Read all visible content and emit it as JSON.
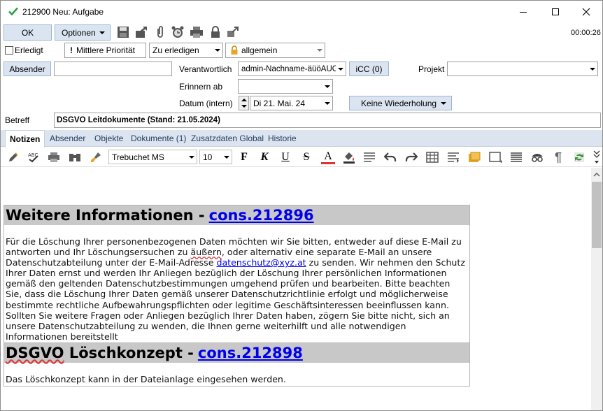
{
  "window": {
    "title": "212900 Neu: Aufgabe",
    "timer": "00:00:26"
  },
  "toolbar": {
    "ok_label": "OK",
    "options_label": "Optionen"
  },
  "row1": {
    "done_label": "Erledigt",
    "priority": "Mittlere Priorität",
    "status": "Zu erledigen",
    "category": "allgemein"
  },
  "row2": {
    "sender_button": "Absender",
    "sender_value": "",
    "responsible_label": "Verantwortlich",
    "responsible_value": "admin-Nachname-äüöÄÜÖß",
    "icc_button": "iCC (0)",
    "project_label": "Projekt",
    "project_value": ""
  },
  "row3": {
    "remind_label": "Erinnern ab",
    "remind_value": ""
  },
  "row4": {
    "date_label": "Datum (intern)",
    "date_value": "Di 21. Mai. 24",
    "repeat_button": "Keine Wiederholung"
  },
  "subject": {
    "label": "Betreff",
    "value": "DSGVO Leitdokumente (Stand: 21.05.2024)"
  },
  "tabs": [
    {
      "label": "Notizen",
      "active": true
    },
    {
      "label": "Absender",
      "active": false
    },
    {
      "label": "Objekte",
      "active": false
    },
    {
      "label": "Dokumente (1)",
      "active": false
    },
    {
      "label": "Zusatzdaten Global",
      "active": false
    },
    {
      "label": "Historie",
      "active": false
    }
  ],
  "editor": {
    "font": "Trebuchet MS",
    "size": "10"
  },
  "document": {
    "section1": {
      "heading": "Weitere Informationen -",
      "link": "cons.212896",
      "text_before": "Für die Löschung Ihrer personenbezogenen Daten möchten wir Sie bitten, entweder auf diese E-Mail zu antworten und Ihr Löschungsersuchen zu ",
      "wavy_word": "äußern",
      "text_mid": ", oder alternativ eine separate E-Mail an unsere Datenschutzabteilung unter der E-Mail-Adresse ",
      "email": "datenschutz@xyz.at",
      "text_after": " zu senden. Wir nehmen den Schutz Ihrer Daten ernst und werden Ihr Anliegen bezüglich der Löschung Ihrer persönlichen Informationen gemäß den geltenden Datenschutzbestimmungen umgehend prüfen und bearbeiten. Bitte beachten Sie, dass die Löschung Ihrer Daten gemäß unserer Datenschutzrichtlinie erfolgt und möglicherweise bestimmte rechtliche Aufbewahrungspflichten oder legitime Geschäftsinteressen beeinflussen kann. Sollten Sie weitere Fragen oder Anliegen bezüglich Ihrer Daten haben, zögern Sie bitte nicht, sich an unsere Datenschutzabteilung zu wenden, die Ihnen gerne weiterhilft und alle notwendigen Informationen bereitstellt"
    },
    "section2": {
      "heading_wavy": "DSGVO",
      "heading_rest": " Löschkonzept -",
      "link": "cons.212898",
      "text": "Das Löschkonzept kann in der Dateianlage eingesehen werden."
    }
  }
}
